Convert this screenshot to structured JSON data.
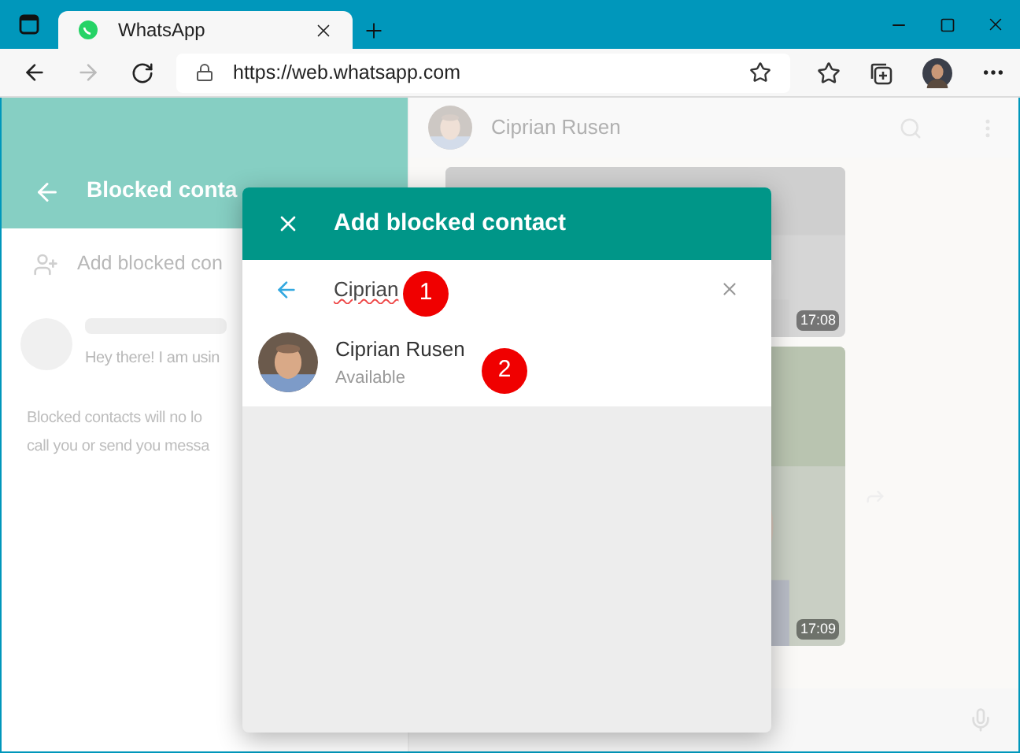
{
  "browser": {
    "tab": {
      "title": "WhatsApp",
      "selected": true
    },
    "url": "https://web.whatsapp.com"
  },
  "sidebar": {
    "title": "Blocked conta",
    "add_label": "Add blocked con",
    "contact_status": "Hey there! I am usin",
    "note_lines": [
      "Blocked contacts will no lo",
      "call you or send you messa"
    ]
  },
  "chat": {
    "contact_name": "Ciprian Rusen",
    "messages": [
      {
        "kind": "picture",
        "time": "17:08"
      },
      {
        "kind": "picture",
        "time": "17:09"
      }
    ]
  },
  "dialog": {
    "title": "Add blocked contact",
    "search": {
      "value": "Ciprian"
    },
    "results": [
      {
        "name": "Ciprian Rusen",
        "status": "Available"
      }
    ]
  },
  "callouts": [
    "1",
    "2"
  ]
}
